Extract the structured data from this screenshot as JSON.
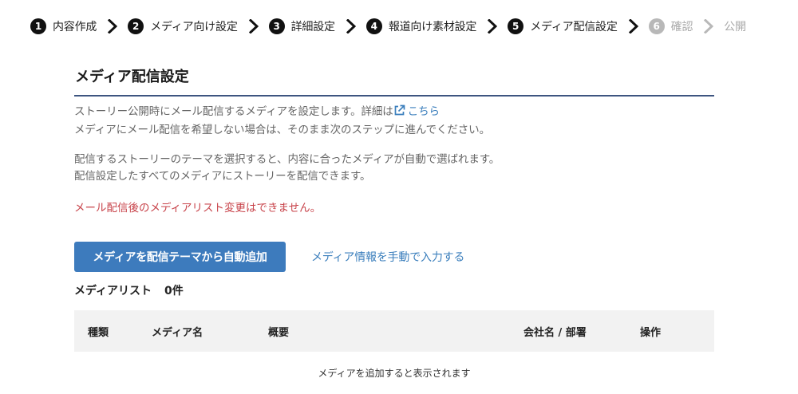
{
  "stepper": {
    "steps": [
      {
        "num": "1",
        "label": "内容作成",
        "state": "done"
      },
      {
        "num": "2",
        "label": "メディア向け設定",
        "state": "done"
      },
      {
        "num": "3",
        "label": "詳細設定",
        "state": "done"
      },
      {
        "num": "4",
        "label": "報道向け素材設定",
        "state": "done"
      },
      {
        "num": "5",
        "label": "メディア配信設定",
        "state": "current"
      },
      {
        "num": "6",
        "label": "確認",
        "state": "disabled"
      },
      {
        "num": "",
        "label": "公開",
        "state": "disabled"
      }
    ]
  },
  "page": {
    "title": "メディア配信設定",
    "desc_line1": "ストーリー公開時にメール配信するメディアを設定します。詳細は",
    "desc_link": "こちら",
    "desc_line2": "メディアにメール配信を希望しない場合は、そのまま次のステップに進んでください。",
    "desc_line3": "配信するストーリーのテーマを選択すると、内容に合ったメディアが自動で選ばれます。",
    "desc_line4": "配信設定したすべてのメディアにストーリーを配信できます。",
    "warning": "メール配信後のメディアリスト変更はできません。"
  },
  "actions": {
    "auto_add_label": "メディアを配信テーマから自動追加",
    "manual_link": "メディア情報を手動で入力する"
  },
  "media_list": {
    "title": "メディアリスト",
    "count": "0件",
    "columns": {
      "type": "種類",
      "media_name": "メディア名",
      "summary": "概要",
      "company": "会社名 / 部署",
      "ops": "操作"
    },
    "empty_message": "メディアを追加すると表示されます"
  },
  "colors": {
    "accent": "#3d7bbd",
    "link": "#3a7ebc",
    "warning": "#c8444b",
    "rule": "#3d5580"
  },
  "icons": {
    "step_separator": "chevron-right-icon",
    "external_link": "external-link-icon"
  }
}
